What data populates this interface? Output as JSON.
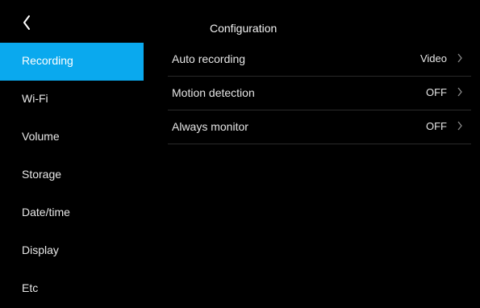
{
  "header": {
    "title": "Configuration",
    "back_icon": "chevron-left-icon"
  },
  "sidebar": {
    "active_color": "#0aa9ee",
    "items": [
      {
        "label": "Recording",
        "active": true
      },
      {
        "label": "Wi-Fi",
        "active": false
      },
      {
        "label": "Volume",
        "active": false
      },
      {
        "label": "Storage",
        "active": false
      },
      {
        "label": "Date/time",
        "active": false
      },
      {
        "label": "Display",
        "active": false
      },
      {
        "label": "Etc",
        "active": false
      }
    ]
  },
  "settings": {
    "rows": [
      {
        "label": "Auto recording",
        "value": "Video",
        "icon": "chevron-right-icon"
      },
      {
        "label": "Motion detection",
        "value": "OFF",
        "icon": "chevron-right-icon"
      },
      {
        "label": "Always monitor",
        "value": "OFF",
        "icon": "chevron-right-icon"
      }
    ]
  }
}
